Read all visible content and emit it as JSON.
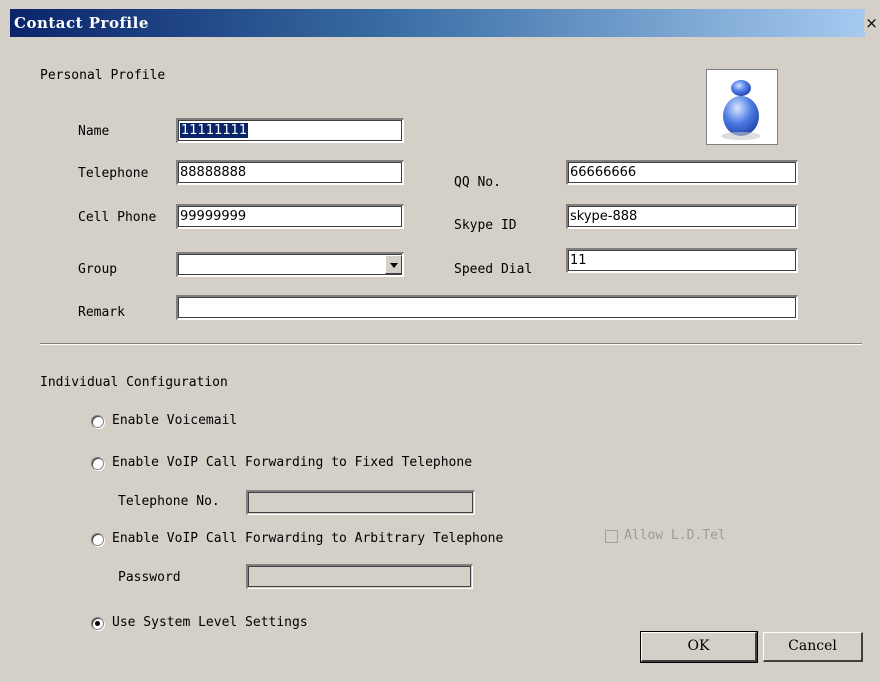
{
  "window": {
    "title": "Contact Profile",
    "close_glyph": "×"
  },
  "personal": {
    "heading": "Personal Profile",
    "name_label": "Name",
    "name_value": "11111111",
    "telephone_label": "Telephone",
    "telephone_value": "88888888",
    "cell_label": "Cell Phone",
    "cell_value": "99999999",
    "group_label": "Group",
    "group_value": "",
    "remark_label": "Remark",
    "remark_value": "",
    "qq_label": "QQ No.",
    "qq_value": "66666666",
    "skype_label": "Skype ID",
    "skype_value": "skype-888",
    "speed_label": "Speed Dial",
    "speed_value": "11"
  },
  "individual": {
    "heading": "Individual Configuration",
    "opt_voicemail": "Enable Voicemail",
    "opt_fixed": "Enable VoIP Call Forwarding to Fixed Telephone",
    "telno_label": "Telephone No.",
    "telno_value": "",
    "opt_arbitrary": "Enable VoIP Call Forwarding to Arbitrary Telephone",
    "allow_ld_label": "Allow L.D.Tel",
    "password_label": "Password",
    "password_value": "",
    "opt_system": "Use System Level Settings"
  },
  "buttons": {
    "ok": "OK",
    "cancel": "Cancel"
  },
  "colors": {
    "titlebar_start": "#0a246a",
    "dialog_bg": "#d4d0c8",
    "avatar_blue": "#2f5fd6"
  },
  "icons": {
    "avatar": "user-avatar-icon"
  }
}
